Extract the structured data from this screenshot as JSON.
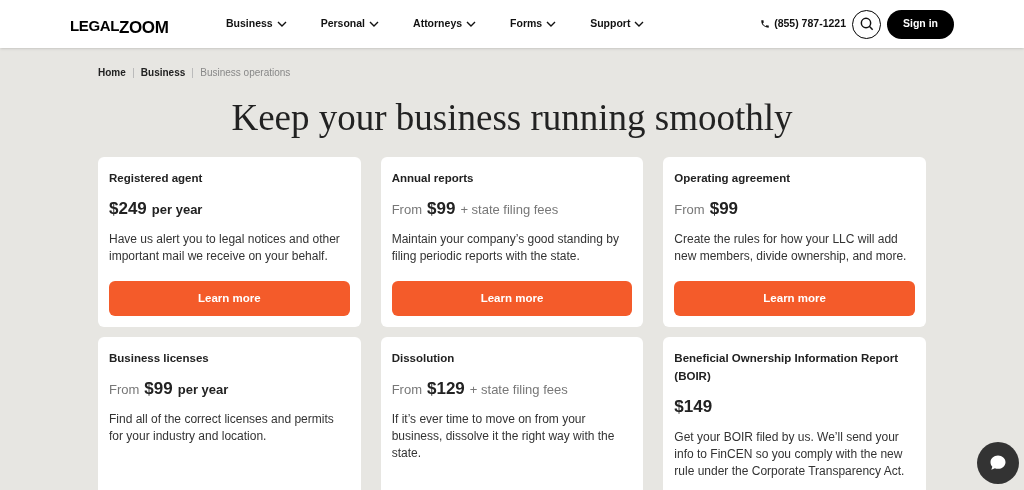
{
  "header": {
    "logo": {
      "first": "LEGAL",
      "second": "ZOOM"
    },
    "nav": [
      {
        "label": "Business"
      },
      {
        "label": "Personal"
      },
      {
        "label": "Attorneys"
      },
      {
        "label": "Forms"
      },
      {
        "label": "Support"
      }
    ],
    "phone": "(855) 787-1221",
    "sign_in": "Sign in"
  },
  "breadcrumb": [
    {
      "label": "Home",
      "current": false
    },
    {
      "label": "Business",
      "current": false
    },
    {
      "label": "Business operations",
      "current": true
    }
  ],
  "heading": "Keep your business running smoothly",
  "cards": [
    {
      "title": "Registered agent",
      "price": {
        "amount": "$249",
        "suffix": "per year",
        "suffix_bold": true
      },
      "description": "Have us alert you to legal notices and other important mail we receive on your behalf.",
      "button": "Learn more"
    },
    {
      "title": "Annual reports",
      "price": {
        "prefix": "From",
        "amount": "$99",
        "suffix": "+ state filing fees",
        "suffix_bold": false
      },
      "description": "Maintain your company’s good standing by filing periodic reports with the state.",
      "button": "Learn more"
    },
    {
      "title": "Operating agreement",
      "price": {
        "prefix": "From",
        "amount": "$99"
      },
      "description": "Create the rules for how your LLC will add new members, divide ownership, and more.",
      "button": "Learn more"
    },
    {
      "title": "Business licenses",
      "price": {
        "prefix": "From",
        "amount": "$99",
        "suffix": "per year",
        "suffix_bold": true
      },
      "description": "Find all of the correct licenses and permits for your industry and location."
    },
    {
      "title": "Dissolution",
      "price": {
        "prefix": "From",
        "amount": "$129",
        "suffix": "+ state filing fees",
        "suffix_bold": false
      },
      "description": "If it’s ever time to move on from your business, dissolve it the right way with the state."
    },
    {
      "title": "Beneficial Ownership Information Report (BOIR)",
      "price": {
        "amount": "$149"
      },
      "description": "Get your BOIR filed by us. We’ll send your info to FinCEN so you comply with the new rule under the Corporate Transparency Act."
    }
  ]
}
